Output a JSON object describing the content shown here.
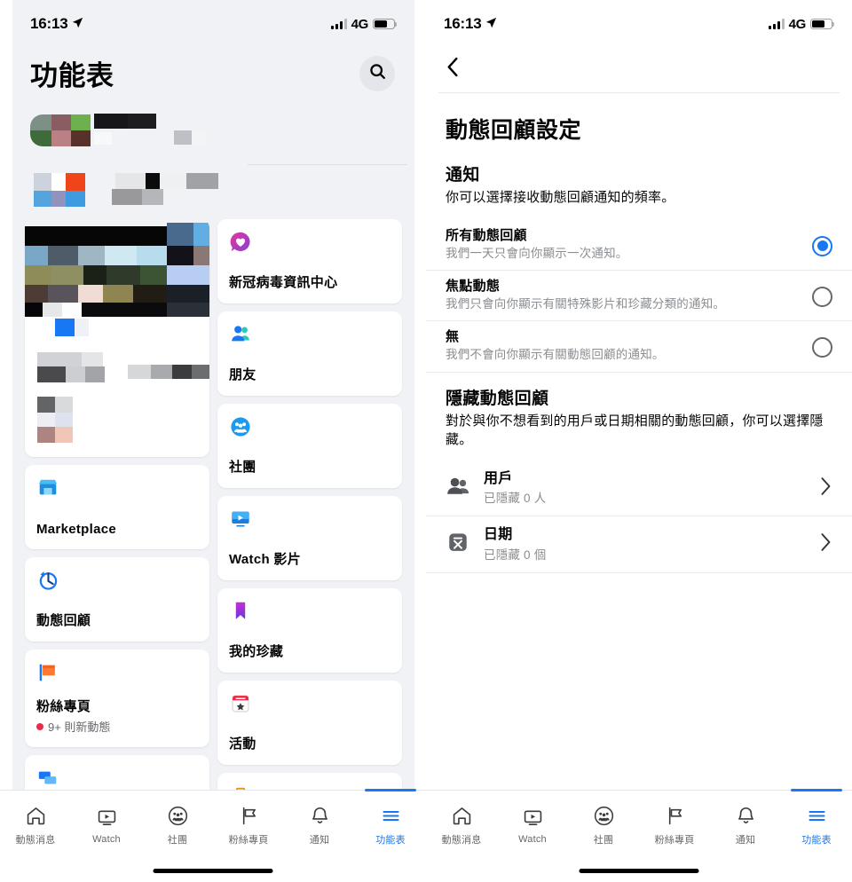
{
  "status_bar": {
    "time": "16:13",
    "location_icon": "location-arrow-icon",
    "network": "4G",
    "signal_icon": "signal-bars-icon",
    "battery_icon": "battery-icon"
  },
  "left_screen": {
    "header": {
      "title": "功能表",
      "search_icon": "search-icon"
    },
    "cards_left_column": [
      {
        "label": "Marketplace",
        "icon": "marketplace-icon",
        "sub": ""
      },
      {
        "label": "動態回顧",
        "icon": "memories-clock-icon",
        "sub": ""
      },
      {
        "label": "粉絲專頁",
        "icon": "pages-flag-icon",
        "sub": "9+ 則新動態",
        "badge": true
      }
    ],
    "cards_right_column": [
      {
        "label": "新冠病毒資訊中心",
        "icon": "covid-info-icon",
        "sub": ""
      },
      {
        "label": "朋友",
        "icon": "friends-icon",
        "sub": ""
      },
      {
        "label": "社團",
        "icon": "groups-icon",
        "sub": ""
      },
      {
        "label": "Watch 影片",
        "icon": "watch-video-icon",
        "sub": ""
      },
      {
        "label": "我的珍藏",
        "icon": "saved-bookmark-icon",
        "sub": ""
      },
      {
        "label": "活動",
        "icon": "events-calendar-icon",
        "sub": ""
      }
    ]
  },
  "right_screen": {
    "nav": {
      "back_icon": "chevron-left-icon"
    },
    "page_title": "動態回顧設定",
    "notifications": {
      "section_title": "通知",
      "section_desc": "你可以選擇接收動態回顧通知的頻率。",
      "options": [
        {
          "title": "所有動態回顧",
          "desc": "我們一天只會向你顯示一次通知。",
          "selected": true
        },
        {
          "title": "焦點動態",
          "desc": "我們只會向你顯示有關特殊影片和珍藏分類的通知。",
          "selected": false
        },
        {
          "title": "無",
          "desc": "我們不會向你顯示有關動態回顧的通知。",
          "selected": false
        }
      ]
    },
    "hide_memories": {
      "section_title": "隱藏動態回顧",
      "section_desc": "對於與你不想看到的用戶或日期相關的動態回顧，你可以選擇隱藏。",
      "rows": [
        {
          "title": "用戶",
          "sub": "已隱藏 0 人",
          "icon": "people-icon",
          "chevron": "chevron-right-icon"
        },
        {
          "title": "日期",
          "sub": "已隱藏 0 個",
          "icon": "date-x-icon",
          "chevron": "chevron-right-icon"
        }
      ]
    }
  },
  "tab_bar": {
    "tabs": [
      {
        "label": "動態消息",
        "icon": "home-icon",
        "active": false
      },
      {
        "label": "Watch",
        "icon": "watch-icon",
        "active": false
      },
      {
        "label": "社團",
        "icon": "groups-circle-icon",
        "active": false
      },
      {
        "label": "粉絲專頁",
        "icon": "flag-icon",
        "active": false
      },
      {
        "label": "通知",
        "icon": "bell-icon",
        "active": false
      },
      {
        "label": "功能表",
        "icon": "hamburger-menu-icon",
        "active": true
      }
    ]
  },
  "colors": {
    "accent": "#1877f2",
    "badge_red": "#f02849",
    "background": "#f0f2f5",
    "text_primary": "#050505",
    "text_secondary": "#65676b",
    "text_muted": "#8a8d91"
  }
}
